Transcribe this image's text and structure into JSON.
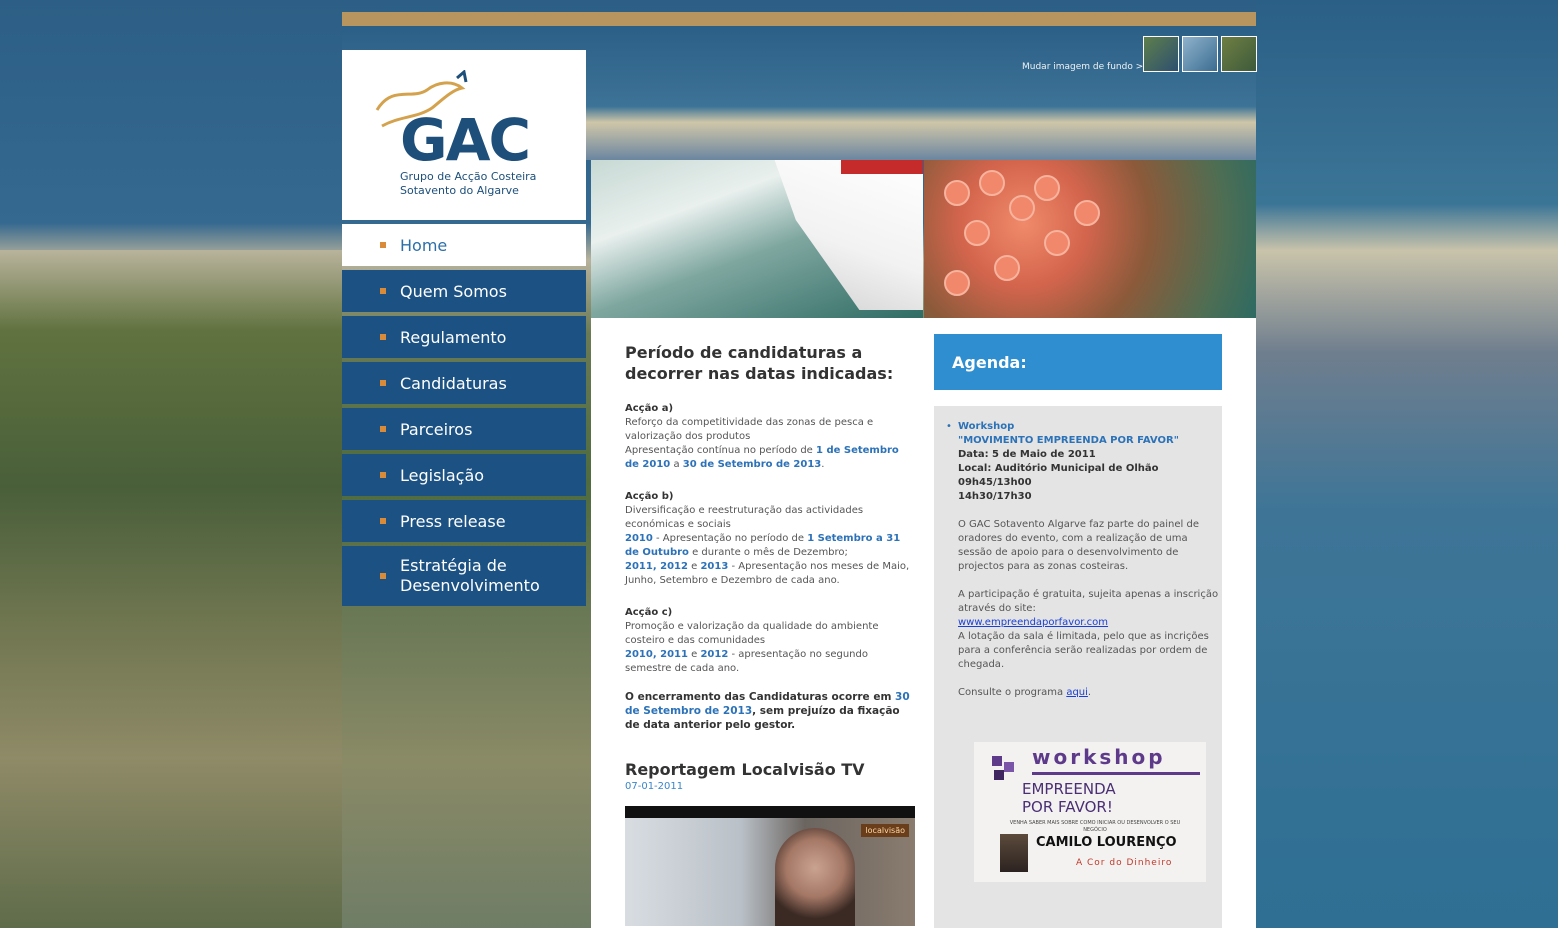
{
  "background_label": "Mudar imagem de fundo >",
  "logo": {
    "name": "GAC",
    "subtitle": "Grupo de Acção Costeira Sotavento do Algarve"
  },
  "nav": [
    {
      "label": "Home",
      "active": true
    },
    {
      "label": "Quem Somos"
    },
    {
      "label": "Regulamento"
    },
    {
      "label": "Candidaturas"
    },
    {
      "label": "Parceiros"
    },
    {
      "label": "Legislação"
    },
    {
      "label": "Press release"
    },
    {
      "label": "Estratégia de Desenvolvimento"
    }
  ],
  "main": {
    "period_title": "Período de candidaturas a decorrer nas datas indicadas:",
    "accao_a": {
      "title": "Acção a)",
      "desc": "Reforço da competitividade das zonas de pesca e valorização dos produtos",
      "text1": "Apresentação contínua no período de ",
      "date1": "1 de Setembro de 2010",
      "text2": " a ",
      "date2": "30 de Setembro de 2013",
      "text3": "."
    },
    "accao_b": {
      "title": "Acção b)",
      "desc": "Diversificação e reestruturação das actividades económicas e sociais",
      "y2010": "2010",
      "text1": " - Apresentação no período de ",
      "date1": "1 Setembro a 31 de Outubro",
      "text2": " e durante o mês de Dezembro;",
      "y2011": "2011, 2012",
      "and": " e ",
      "y2013": "2013",
      "text3": " - Apresentação nos meses de Maio, Junho, Setembro e Dezembro de cada ano."
    },
    "accao_c": {
      "title": "Acção c)",
      "desc": "Promoção e valorização da qualidade do ambiente costeiro e das comunidades",
      "years": "2010, 2011",
      "and": " e ",
      "y2012": "2012",
      "text": " - apresentação no segundo semestre de cada ano."
    },
    "closing_pre": "O encerramento das Candidaturas ocorre em ",
    "closing_date": "30 de Setembro de 2013",
    "closing_post": ", sem prejuízo da fixação de data anterior pelo gestor.",
    "report_title": "Reportagem Localvisão TV",
    "report_date": "07-01-2011",
    "video_tag": "localvisão"
  },
  "agenda": {
    "title": "Agenda:",
    "item_title": "Workshop",
    "item_name": "\"MOVIMENTO EMPREENDA POR FAVOR\"",
    "date": "Data: 5 de Maio de 2011",
    "local": "Local: Auditório Municipal de Olhão",
    "time1": "09h45/13h00",
    "time2": "14h30/17h30",
    "p1": "O GAC Sotavento Algarve faz parte do painel de oradores do evento, com a realização de uma sessão de apoio para o desenvolvimento de projectos para as zonas costeiras.",
    "p2": "A participação é gratuita, sujeita apenas a inscrição através do site:",
    "link": "www.empreendaporfavor.com",
    "p3": "A lotação da sala é limitada, pelo que as incrições para a conferência serão realizadas por ordem de chegada.",
    "program_pre": "Consulte o programa ",
    "program_link": "aqui",
    "program_post": "."
  },
  "banner": {
    "ws": "workshop",
    "emp1": "EMPREENDA",
    "emp2": "POR FAVOR!",
    "small": "VENHA SABER MAIS SOBRE COMO INICIAR OU DESENVOLVER O SEU NEGÓCIO",
    "name": "CAMILO LOURENÇO",
    "cor": "A Cor do Dinheiro"
  },
  "colors": {
    "nav_bg": "#1c5283",
    "accent": "#2f8ed0",
    "topbar": "#b8955f"
  }
}
